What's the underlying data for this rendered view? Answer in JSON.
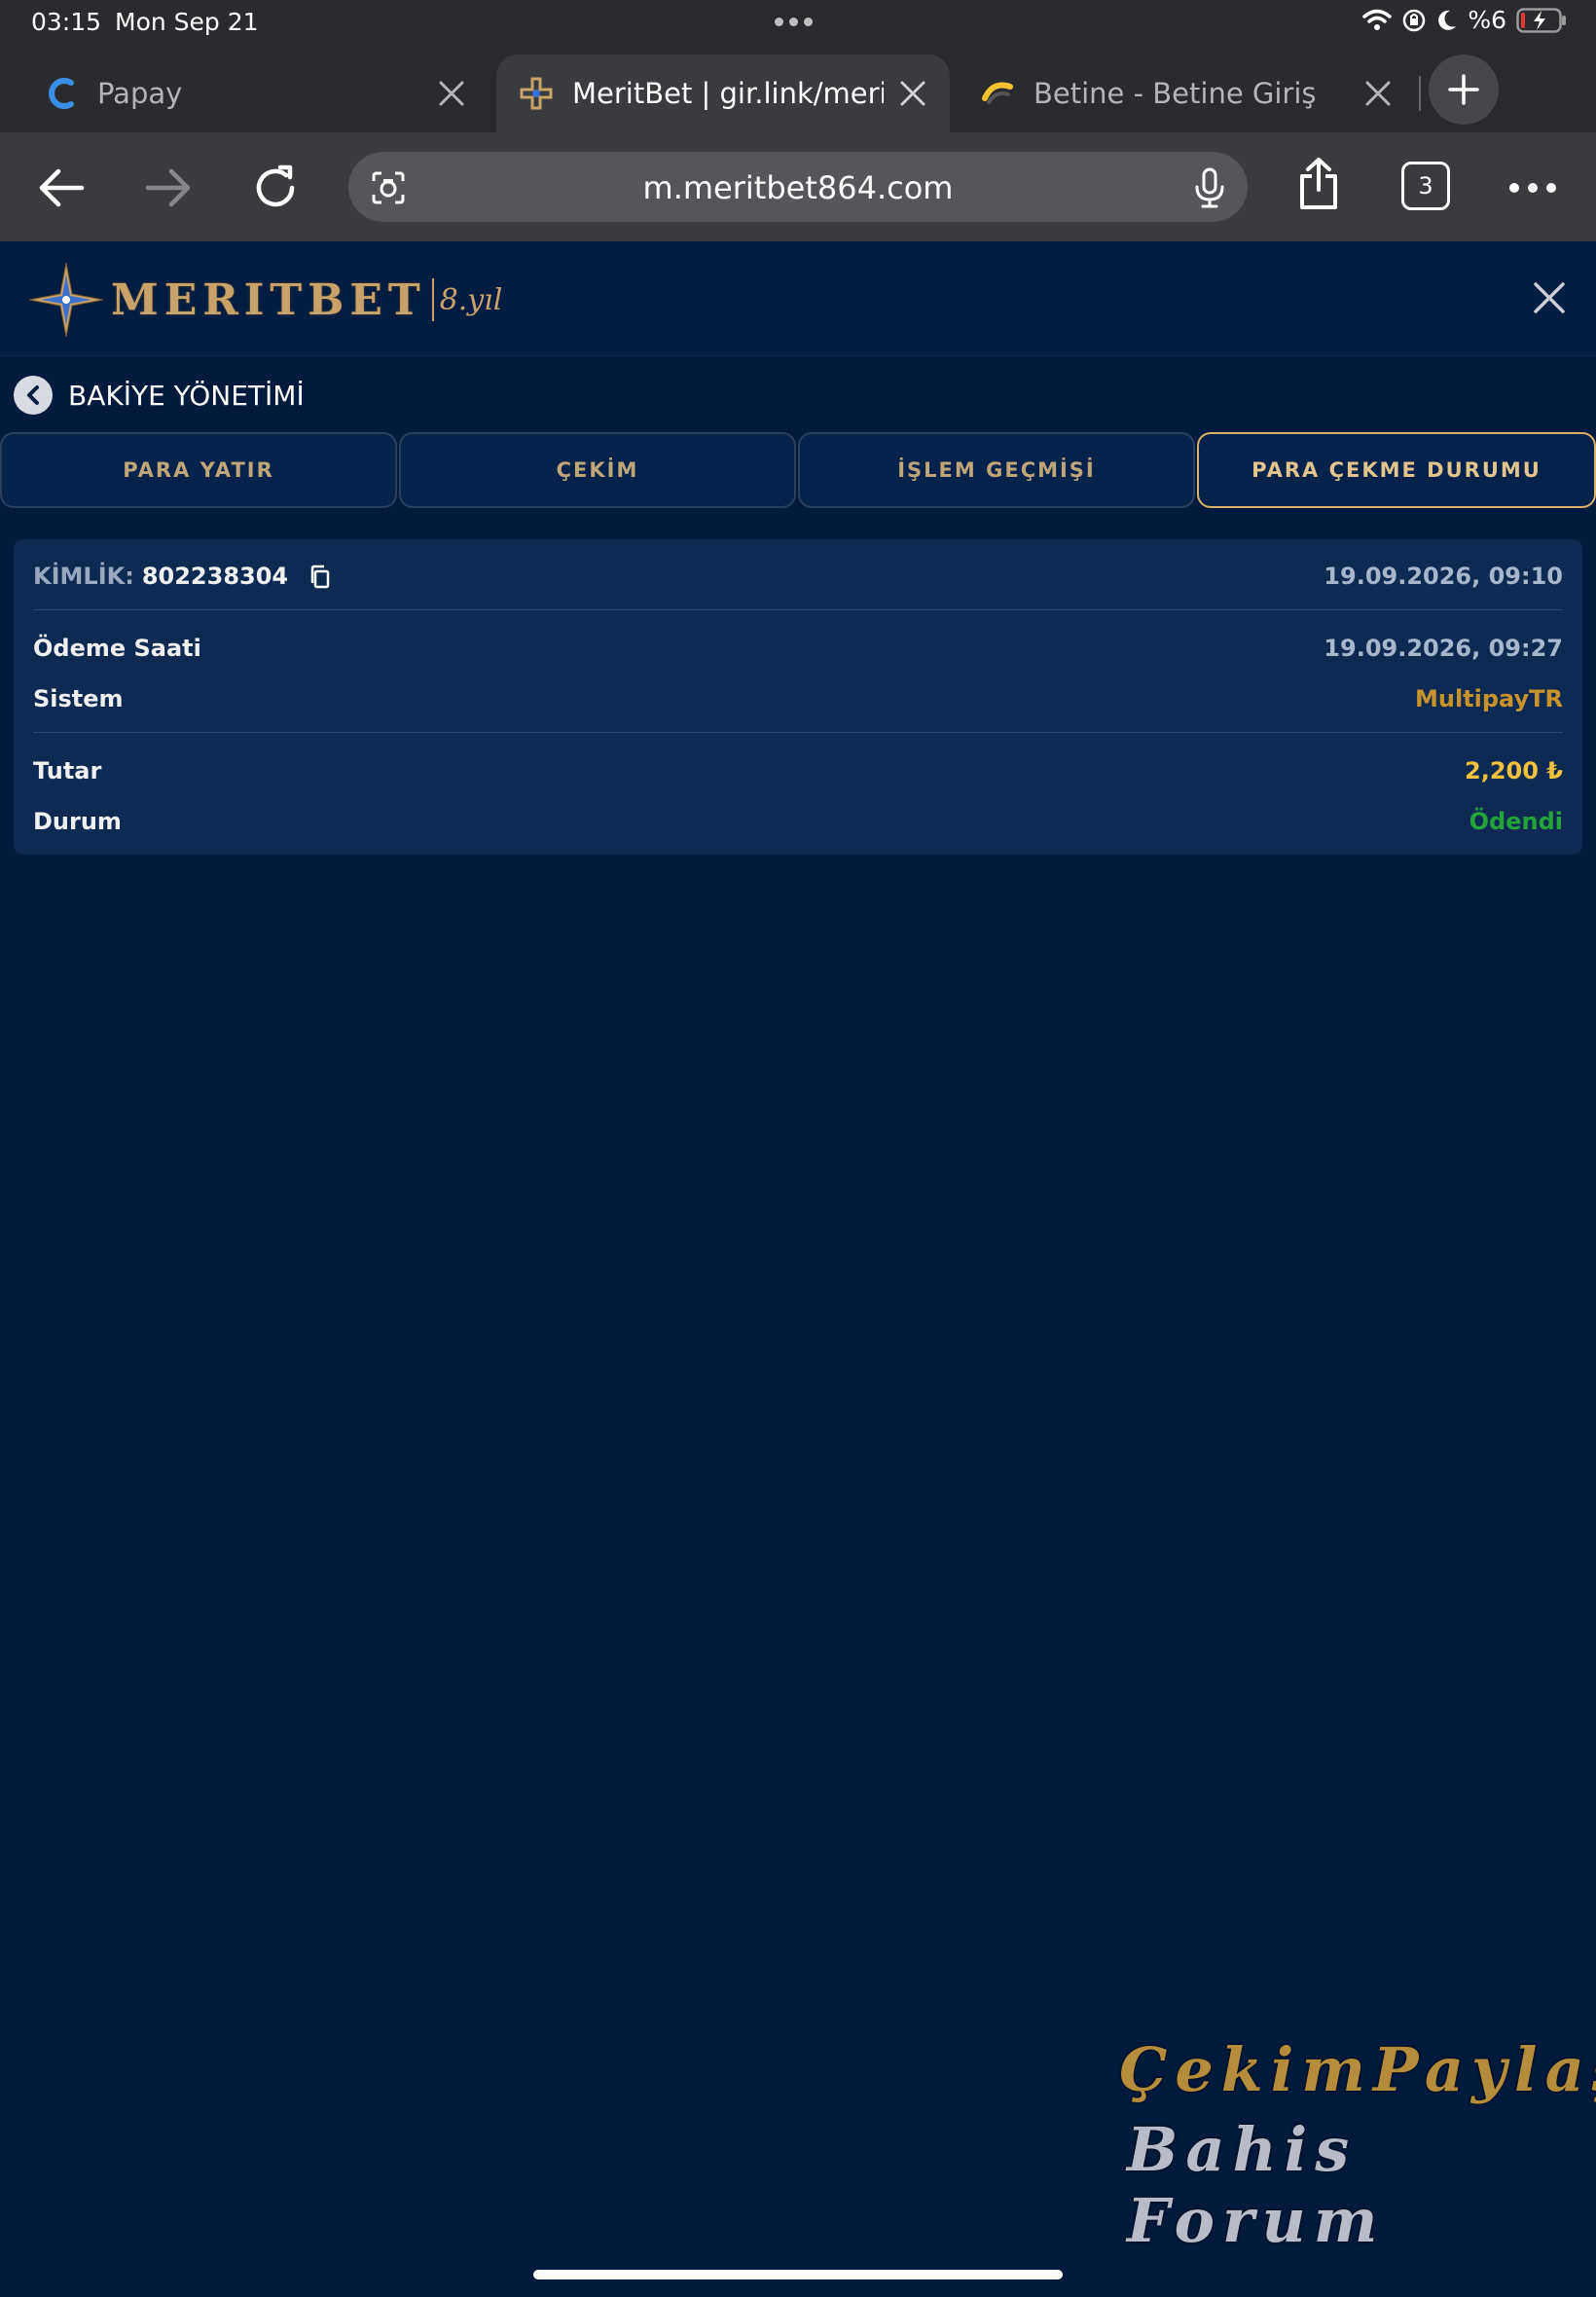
{
  "status_bar": {
    "time": "03:15",
    "date": "Mon Sep 21",
    "battery": "%6"
  },
  "tabs": [
    {
      "title": "Papay",
      "active": false
    },
    {
      "title": "MeritBet | gir.link/merit |",
      "active": true
    },
    {
      "title": "Betine - Betine Giriş",
      "active": false
    }
  ],
  "toolbar": {
    "url": "m.meritbet864.com",
    "tab_count": "3"
  },
  "site": {
    "logo_text": "MERITBET",
    "logo_sub": "8.yıl"
  },
  "balance": {
    "title": "BAKİYE YÖNETİMİ",
    "tabs": [
      "PARA YATIR",
      "ÇEKİM",
      "İŞLEM GEÇMİŞİ",
      "PARA ÇEKME DURUMU"
    ],
    "active_tab": 3
  },
  "record": {
    "id_label": "KİMLİK:",
    "id_value": "802238304",
    "created": "19.09.2026, 09:10",
    "payment_time_label": "Ödeme Saati",
    "payment_time": "19.09.2026, 09:27",
    "system_label": "Sistem",
    "system": "MultipayTR",
    "amount_label": "Tutar",
    "amount": "2,200 ₺",
    "status_label": "Durum",
    "status": "Ödendi"
  },
  "watermark": {
    "line1": "ÇekimPaylaş",
    "line2": "Bahis Forum"
  },
  "colors": {
    "page_bg": "#021a3d",
    "card_bg": "#0f2a52",
    "gold": "#c7a26a",
    "amount": "#f0c23c",
    "paid": "#23a33a"
  }
}
